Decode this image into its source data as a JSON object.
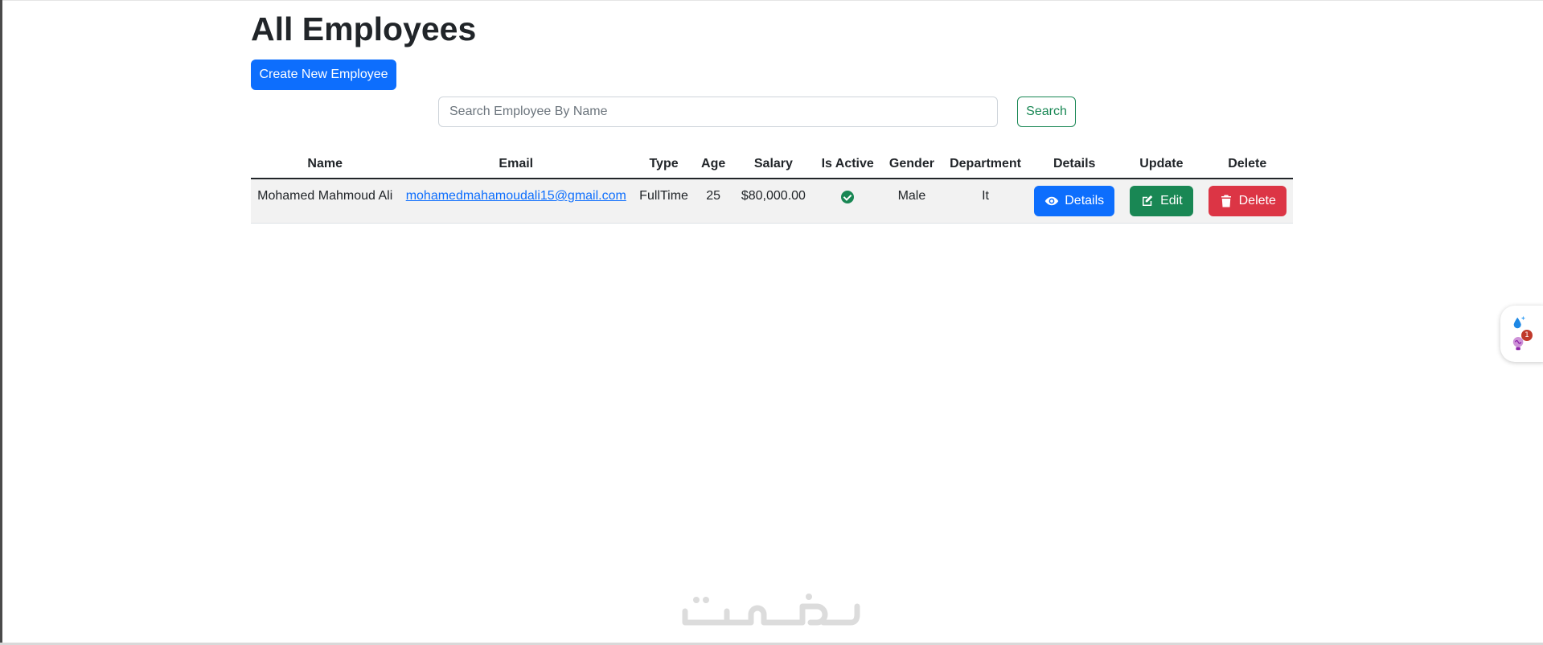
{
  "page": {
    "title": "All Employees",
    "create_button_label": "Create New Employee"
  },
  "search": {
    "placeholder": "Search Employee By Name",
    "value": "",
    "button_label": "Search"
  },
  "table": {
    "headers": [
      "Name",
      "Email",
      "Type",
      "Age",
      "Salary",
      "Is Active",
      "Gender",
      "Department",
      "Details",
      "Update",
      "Delete"
    ],
    "rows": [
      {
        "name": "Mohamed Mahmoud Ali",
        "email": "mohamedmahamoudali15@gmail.com",
        "type": "FullTime",
        "age": "25",
        "salary": "$80,000.00",
        "is_active": true,
        "gender": "Male",
        "department": "It",
        "details_label": "Details",
        "edit_label": "Edit",
        "delete_label": "Delete"
      }
    ]
  },
  "widget": {
    "badge_count": "1"
  },
  "icons": {
    "active": "check-circle-icon",
    "details": "eye-icon",
    "edit": "edit-icon",
    "delete": "trash-icon",
    "widget_top": "water-drop-icon",
    "widget_bottom": "brain-bulb-icon"
  },
  "colors": {
    "primary": "#0d6efd",
    "success": "#198754",
    "danger": "#dc3545",
    "row_background": "#f2f2f2",
    "watermark": "#dcdcdc"
  }
}
